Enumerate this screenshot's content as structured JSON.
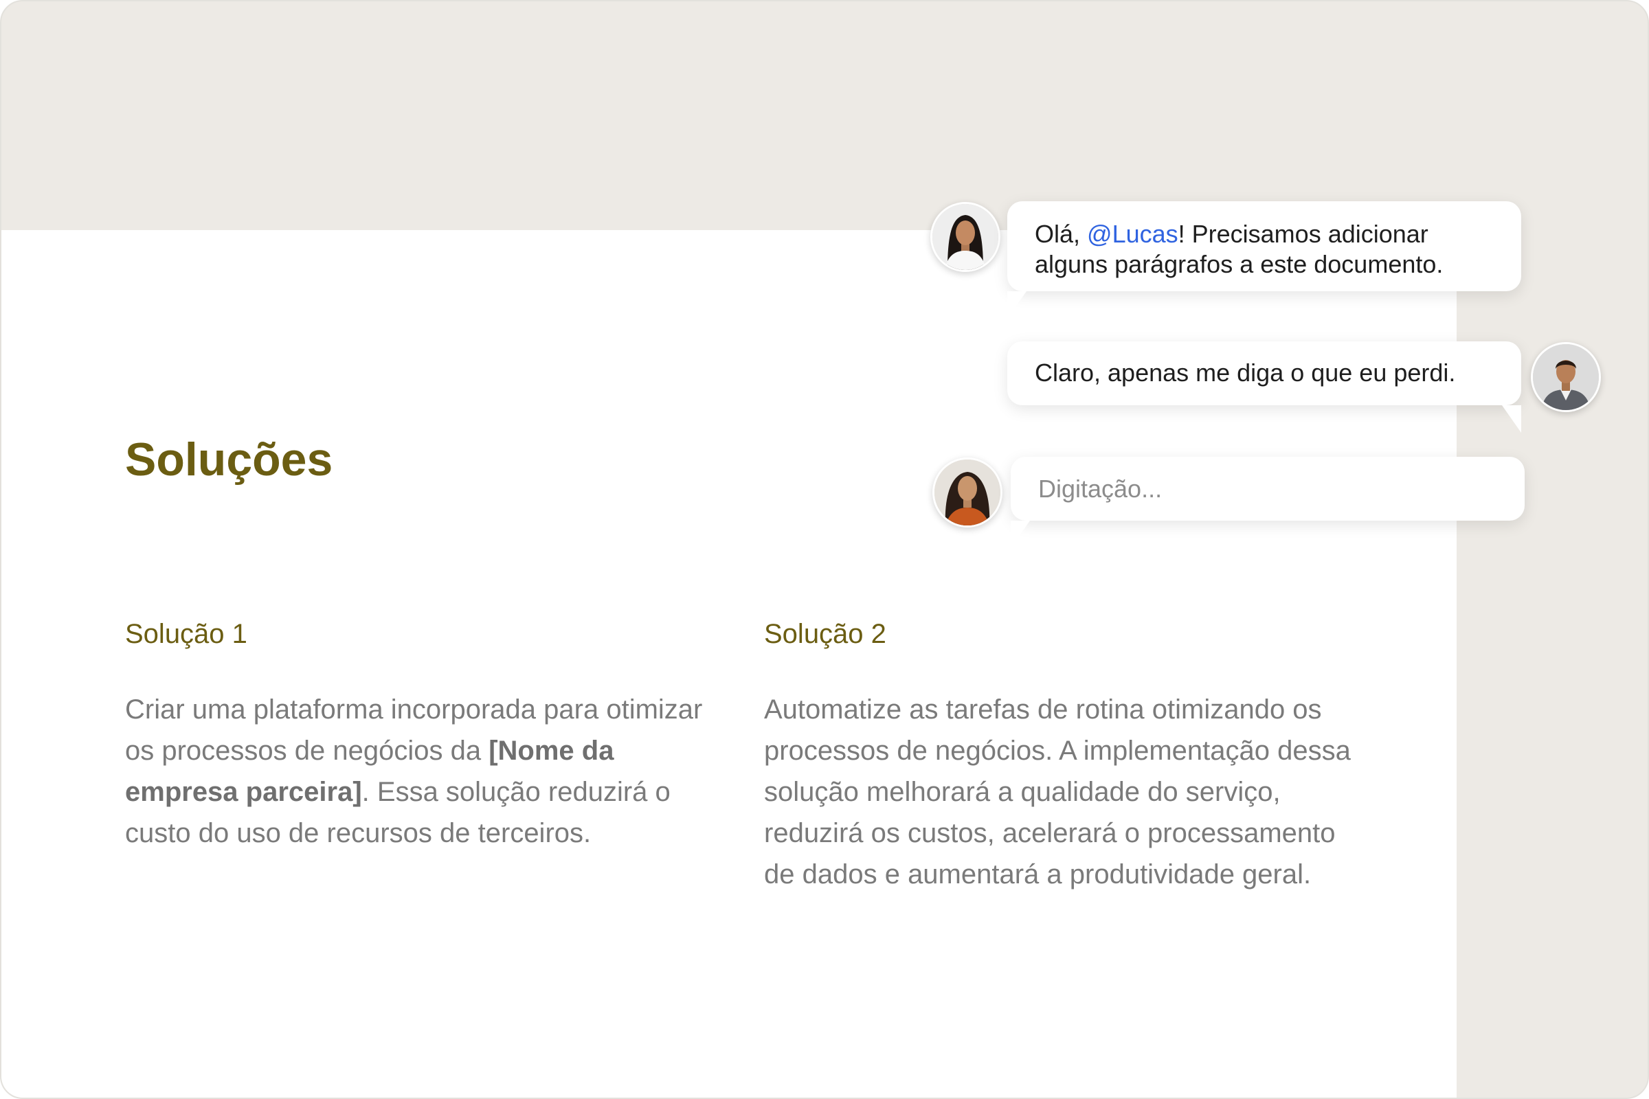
{
  "document": {
    "title": "Soluções",
    "columns": [
      {
        "heading": "Solução 1",
        "text_before": "Criar uma plataforma incorporada para otimizar os processos de negócios da ",
        "bold": "[Nome da empresa parceira]",
        "text_after": ". Essa solução reduzirá o custo do uso de recursos de terceiros."
      },
      {
        "heading": "Solução 2",
        "text": "Automatize as tarefas de rotina otimizando os processos de negócios. A implementação dessa solução melhorará a qualidade do serviço, reduzirá os custos, acelerará o processamento de dados e aumentará a produtividade geral."
      }
    ]
  },
  "chat": {
    "messages": [
      {
        "avatar": "woman-avatar-1",
        "prefix": "Olá, ",
        "mention": "@Lucas",
        "suffix": "! Precisamos adicionar alguns parágrafos a este documento."
      },
      {
        "avatar": "man-avatar",
        "text": "Claro, apenas me diga o que eu perdi."
      }
    ],
    "input": {
      "avatar": "woman-avatar-2",
      "placeholder": "Digitação..."
    }
  },
  "colors": {
    "accent": "#6b5d12",
    "mention": "#2f63e0",
    "background": "#edeae5",
    "body_text": "#7a7a7a"
  }
}
